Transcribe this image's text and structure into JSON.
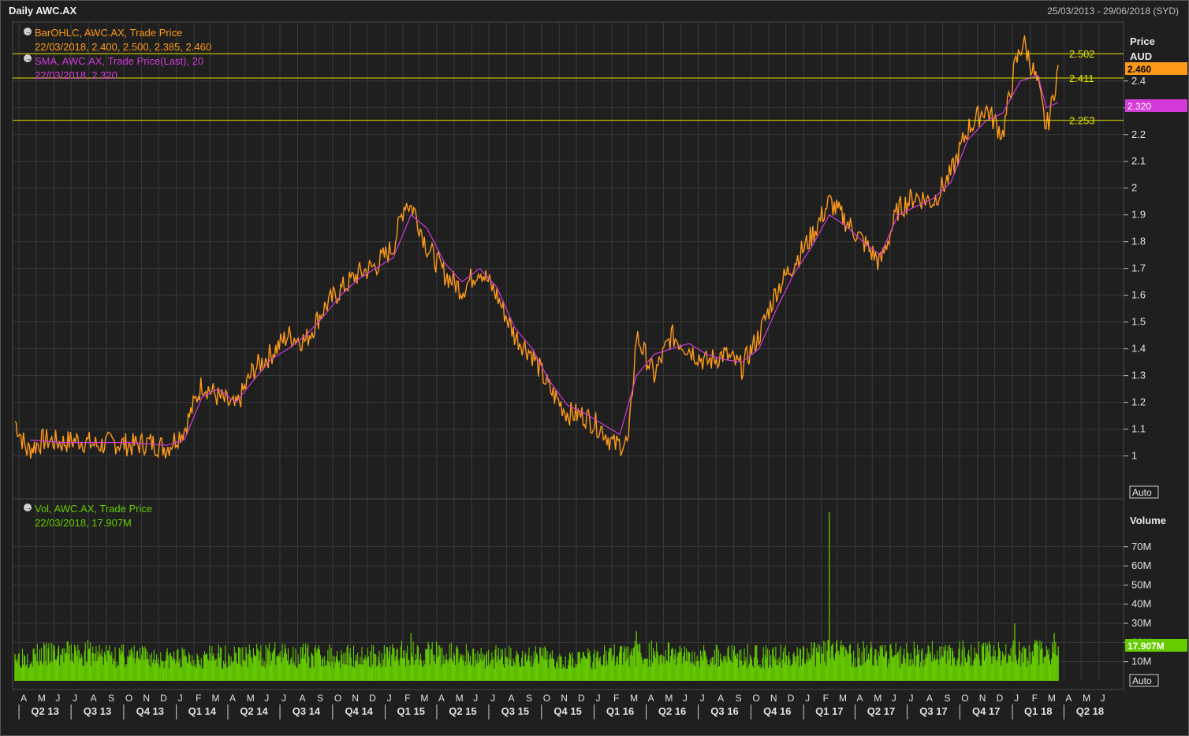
{
  "header": {
    "title": "Daily AWC.AX",
    "date_range": "25/03/2013 - 29/06/2018 (SYD)"
  },
  "colors": {
    "background": "#1f1f1f",
    "grid": "#3a3a3a",
    "price": "#ff9a1a",
    "sma": "#d23bd8",
    "volume": "#66cc00",
    "hline": "#e6e600",
    "text": "#d8d8d8"
  },
  "price_panel": {
    "axis_title": "Price",
    "axis_unit": "AUD",
    "auto_label": "Auto",
    "legend": [
      {
        "icon": "arrow-circle-icon",
        "line1": "BarOHLC, AWC.AX, Trade Price",
        "line2": "22/03/2018, 2.400, 2.500, 2.385, 2.460",
        "color": "#ff9a1a"
      },
      {
        "icon": "arrow-circle-icon",
        "line1": "SMA, AWC.AX, Trade Price(Last),  20",
        "line2": "22/03/2018, 2.320",
        "color": "#d23bd8"
      }
    ],
    "last_price_badge": "2.460",
    "sma_badge": "2.320",
    "horizontal_lines": [
      {
        "value": 2.502,
        "label": "2.502"
      },
      {
        "value": 2.411,
        "label": "2.411"
      },
      {
        "value": 2.253,
        "label": "2.253"
      }
    ]
  },
  "volume_panel": {
    "axis_title": "Volume",
    "auto_label": "Auto",
    "legend": {
      "icon": "arrow-circle-icon",
      "line1": "Vol, AWC.AX, Trade Price",
      "line2": "22/03/2018, 17.907M",
      "color": "#66cc00"
    },
    "last_volume_badge": "17.907M"
  },
  "chart_data": [
    {
      "type": "line",
      "title": "Daily AWC.AX",
      "subtitle": "25/03/2013 - 29/06/2018 (SYD)",
      "xlabel": "",
      "ylabel": "Price AUD",
      "ylim": [
        0.84,
        2.62
      ],
      "yticks": [
        1,
        1.1,
        1.2,
        1.3,
        1.4,
        1.5,
        1.6,
        1.7,
        1.8,
        1.9,
        2,
        2.1,
        2.2,
        2.3,
        2.4
      ],
      "ytick_labels": [
        "1",
        "1.1",
        "1.2",
        "1.3",
        "1.4",
        "1.5",
        "1.6",
        "1.7",
        "1.8",
        "1.9",
        "2",
        "2.1",
        "2.2",
        "2.3",
        "2.4"
      ],
      "grid": true,
      "x_months": [
        "A",
        "M",
        "J",
        "J",
        "A",
        "S",
        "O",
        "N",
        "D",
        "J",
        "F",
        "M",
        "A",
        "M",
        "J",
        "J",
        "A",
        "S",
        "O",
        "N",
        "D",
        "J",
        "F",
        "M",
        "A",
        "M",
        "J",
        "J",
        "A",
        "S",
        "O",
        "N",
        "D",
        "J",
        "F",
        "M",
        "A",
        "M",
        "J",
        "J",
        "A",
        "S",
        "O",
        "N",
        "D",
        "J",
        "F",
        "M",
        "A",
        "M",
        "J",
        "J",
        "A",
        "S",
        "O",
        "N",
        "D",
        "J",
        "F",
        "M",
        "A",
        "M",
        "J"
      ],
      "x_quarters": [
        "Q2 13",
        "Q3 13",
        "Q4 13",
        "Q1 14",
        "Q2 14",
        "Q3 14",
        "Q4 14",
        "Q1 15",
        "Q2 15",
        "Q3 15",
        "Q4 15",
        "Q1 16",
        "Q2 16",
        "Q3 16",
        "Q4 16",
        "Q1 17",
        "Q2 17",
        "Q3 17",
        "Q4 17",
        "Q1 18",
        "Q2 18"
      ],
      "series": [
        {
          "name": "BarOHLC, AWC.AX, Trade Price",
          "x": [
            "2013-03-25",
            "2013-04-15",
            "2013-05-15",
            "2013-06-15",
            "2013-07-15",
            "2013-08-15",
            "2013-09-15",
            "2013-10-15",
            "2013-11-15",
            "2013-12-15",
            "2014-01-15",
            "2014-02-15",
            "2014-03-15",
            "2014-04-15",
            "2014-05-15",
            "2014-06-15",
            "2014-07-15",
            "2014-08-15",
            "2014-09-15",
            "2014-10-15",
            "2014-11-15",
            "2014-12-15",
            "2015-01-15",
            "2015-02-05",
            "2015-02-20",
            "2015-03-15",
            "2015-04-15",
            "2015-05-15",
            "2015-06-15",
            "2015-07-15",
            "2015-08-15",
            "2015-09-15",
            "2015-10-15",
            "2015-11-15",
            "2015-12-15",
            "2016-01-15",
            "2016-02-05",
            "2016-03-01",
            "2016-03-15",
            "2016-04-15",
            "2016-05-15",
            "2016-06-15",
            "2016-07-15",
            "2016-08-15",
            "2016-09-15",
            "2016-10-15",
            "2016-11-15",
            "2016-12-15",
            "2017-01-15",
            "2017-02-15",
            "2017-03-15",
            "2017-04-15",
            "2017-05-15",
            "2017-06-15",
            "2017-07-15",
            "2017-08-15",
            "2017-09-15",
            "2017-10-15",
            "2017-11-15",
            "2017-12-15",
            "2018-01-05",
            "2018-01-20",
            "2018-02-15",
            "2018-03-01",
            "2018-03-10",
            "2018-03-22"
          ],
          "y": [
            1.13,
            1.02,
            1.06,
            1.05,
            1.06,
            1.04,
            1.05,
            1.04,
            1.05,
            1.03,
            1.1,
            1.27,
            1.22,
            1.18,
            1.32,
            1.38,
            1.45,
            1.43,
            1.55,
            1.62,
            1.68,
            1.71,
            1.78,
            1.95,
            1.92,
            1.78,
            1.68,
            1.62,
            1.7,
            1.6,
            1.45,
            1.38,
            1.25,
            1.16,
            1.15,
            1.1,
            1.04,
            1.05,
            1.45,
            1.3,
            1.45,
            1.4,
            1.35,
            1.38,
            1.33,
            1.45,
            1.62,
            1.72,
            1.82,
            1.95,
            1.88,
            1.8,
            1.72,
            1.92,
            1.97,
            1.95,
            2.05,
            2.22,
            2.3,
            2.2,
            2.45,
            2.55,
            2.38,
            2.22,
            2.3,
            2.46
          ]
        },
        {
          "name": "SMA, AWC.AX, Trade Price(Last),  20",
          "x": [
            "2013-04-20",
            "2013-06-15",
            "2013-08-15",
            "2013-10-15",
            "2013-12-15",
            "2014-01-15",
            "2014-02-15",
            "2014-03-15",
            "2014-04-15",
            "2014-05-15",
            "2014-06-15",
            "2014-07-15",
            "2014-08-15",
            "2014-09-15",
            "2014-10-15",
            "2014-11-15",
            "2014-12-15",
            "2015-01-15",
            "2015-02-15",
            "2015-03-15",
            "2015-04-15",
            "2015-05-15",
            "2015-06-15",
            "2015-07-15",
            "2015-08-15",
            "2015-09-15",
            "2015-10-15",
            "2015-11-15",
            "2015-12-15",
            "2016-01-15",
            "2016-02-15",
            "2016-03-15",
            "2016-04-15",
            "2016-05-15",
            "2016-06-15",
            "2016-07-15",
            "2016-08-15",
            "2016-09-15",
            "2016-10-15",
            "2016-11-15",
            "2016-12-15",
            "2017-01-15",
            "2017-02-15",
            "2017-03-15",
            "2017-04-15",
            "2017-05-15",
            "2017-06-15",
            "2017-07-15",
            "2017-08-15",
            "2017-09-15",
            "2017-10-15",
            "2017-11-15",
            "2017-12-15",
            "2018-01-15",
            "2018-02-15",
            "2018-03-01",
            "2018-03-22"
          ],
          "y": [
            1.06,
            1.05,
            1.05,
            1.05,
            1.04,
            1.06,
            1.22,
            1.25,
            1.2,
            1.28,
            1.36,
            1.4,
            1.45,
            1.52,
            1.6,
            1.66,
            1.7,
            1.74,
            1.9,
            1.85,
            1.72,
            1.65,
            1.7,
            1.63,
            1.48,
            1.4,
            1.28,
            1.19,
            1.16,
            1.12,
            1.08,
            1.3,
            1.38,
            1.4,
            1.42,
            1.38,
            1.36,
            1.35,
            1.4,
            1.55,
            1.68,
            1.78,
            1.9,
            1.86,
            1.8,
            1.75,
            1.9,
            1.93,
            1.96,
            2.02,
            2.18,
            2.25,
            2.28,
            2.4,
            2.42,
            2.3,
            2.32
          ]
        }
      ]
    },
    {
      "type": "bar",
      "title": "Vol, AWC.AX, Trade Price",
      "xlabel": "",
      "ylabel": "Volume",
      "ylim": [
        0,
        95
      ],
      "yticks": [
        10,
        20,
        30,
        40,
        50,
        60,
        70
      ],
      "ytick_labels": [
        "10M",
        "20M",
        "30M",
        "40M",
        "50M",
        "60M",
        "70M"
      ],
      "grid": true,
      "series": [
        {
          "name": "Vol, AWC.AX, Trade Price",
          "x": [
            "2013-03-25",
            "2013-07-15",
            "2013-12-15",
            "2014-06-15",
            "2014-12-15",
            "2015-02-15",
            "2015-06-15",
            "2015-12-15",
            "2016-03-15",
            "2016-06-15",
            "2016-12-15",
            "2017-02-15",
            "2017-06-15",
            "2017-11-15",
            "2018-01-05",
            "2018-03-15",
            "2018-03-22"
          ],
          "values": [
            14,
            16,
            13,
            15,
            14,
            25,
            14,
            13,
            26,
            15,
            14,
            88,
            15,
            20,
            30,
            25,
            17.907
          ]
        }
      ]
    }
  ]
}
